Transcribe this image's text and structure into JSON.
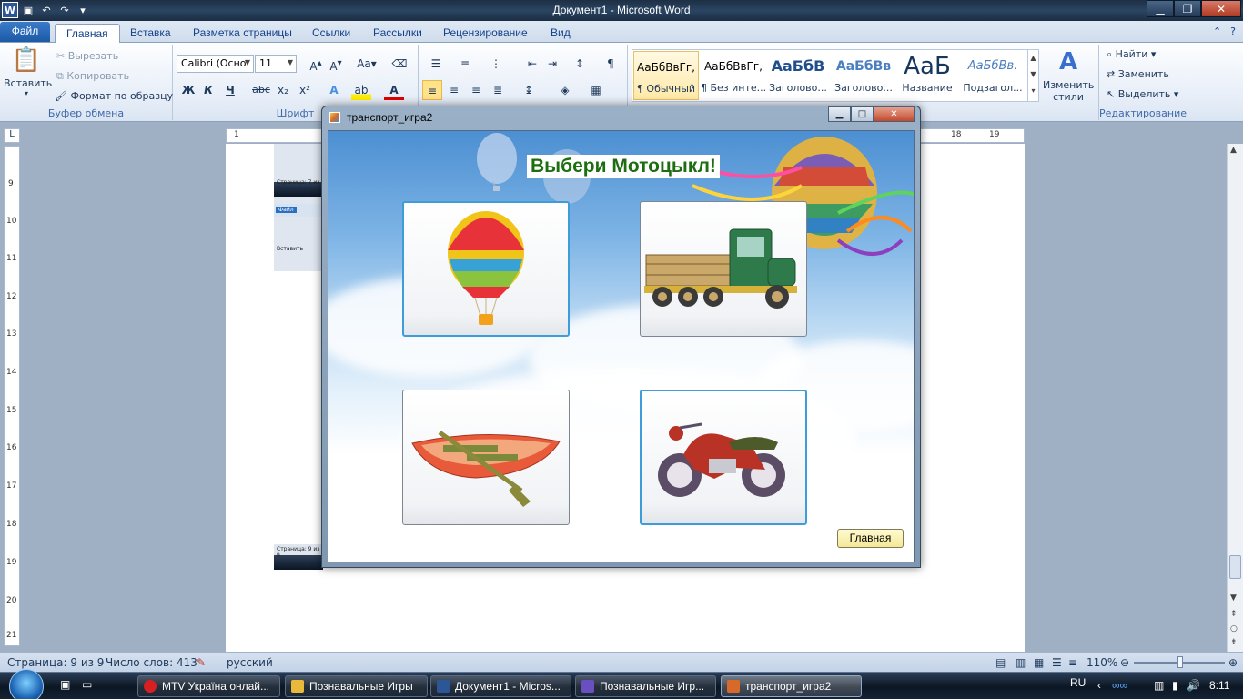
{
  "word": {
    "title": "Документ1  -  Microsoft Word",
    "tabs": [
      "Файл",
      "Главная",
      "Вставка",
      "Разметка страницы",
      "Ссылки",
      "Рассылки",
      "Рецензирование",
      "Вид"
    ],
    "clipboard": {
      "paste": "Вставить",
      "cut": "Вырезать",
      "copy": "Копировать",
      "format_painter": "Формат по образцу",
      "label": "Буфер обмена"
    },
    "font": {
      "name": "Calibri (Осно",
      "size": "11",
      "label": "Шрифт",
      "bold": "Ж",
      "italic": "К",
      "underline": "Ч",
      "strike": "abc",
      "case": "Aa"
    },
    "styles": [
      {
        "sample": "АаБбВвГг,",
        "name": "¶ Обычный"
      },
      {
        "sample": "АаБбВвГг,",
        "name": "¶ Без инте..."
      },
      {
        "sample": "АаБбВ",
        "name": "Заголово..."
      },
      {
        "sample": "АаБбВв",
        "name": "Заголово..."
      },
      {
        "sample": "АаБ",
        "name": "Название"
      },
      {
        "sample": "АаБбВв.",
        "name": "Подзагол..."
      }
    ],
    "change_styles": "Изменить стили",
    "editing": {
      "find": "Найти",
      "replace": "Заменить",
      "select": "Выделить",
      "label": "Редактирование"
    },
    "ruler_h": [
      "1",
      "18",
      "19"
    ],
    "ruler_v": [
      "9",
      "10",
      "11",
      "12",
      "13",
      "14",
      "15",
      "16",
      "17",
      "18",
      "19",
      "20",
      "21"
    ],
    "thumb": {
      "page_a": "Страница: 7 из 7",
      "page_b": "Страница: 9 из 9",
      "file": "Файл",
      "paste": "Вставить"
    },
    "status": {
      "page": "Страница: 9 из 9",
      "words": "Число слов: 413",
      "language": "русский",
      "zoom": "110%"
    }
  },
  "taskbar": {
    "items": [
      {
        "label": "MTV Україна онлай...",
        "color": "#d82020"
      },
      {
        "label": "Познавальные Игры",
        "color": "#e8b93a"
      },
      {
        "label": "Документ1 - Micros...",
        "color": "#2b5797"
      },
      {
        "label": "Познавальные Игр...",
        "color": "#6a4fbf"
      },
      {
        "label": "транспорт_игра2",
        "color": "#d76a2a"
      }
    ],
    "lang": "RU",
    "time": "8:11"
  },
  "app": {
    "title": "транспорт_игра2",
    "heading": "Выбери Мотоцыкл!",
    "choices": [
      {
        "item": "hot-air-balloon"
      },
      {
        "item": "truck"
      },
      {
        "item": "rowing-boat"
      },
      {
        "item": "motorcycle"
      }
    ],
    "home_button": "Главная"
  },
  "colors": {
    "heading_text": "#1d6e10",
    "focus_border": "#3e9cd8",
    "home_button": "#f4e797"
  }
}
